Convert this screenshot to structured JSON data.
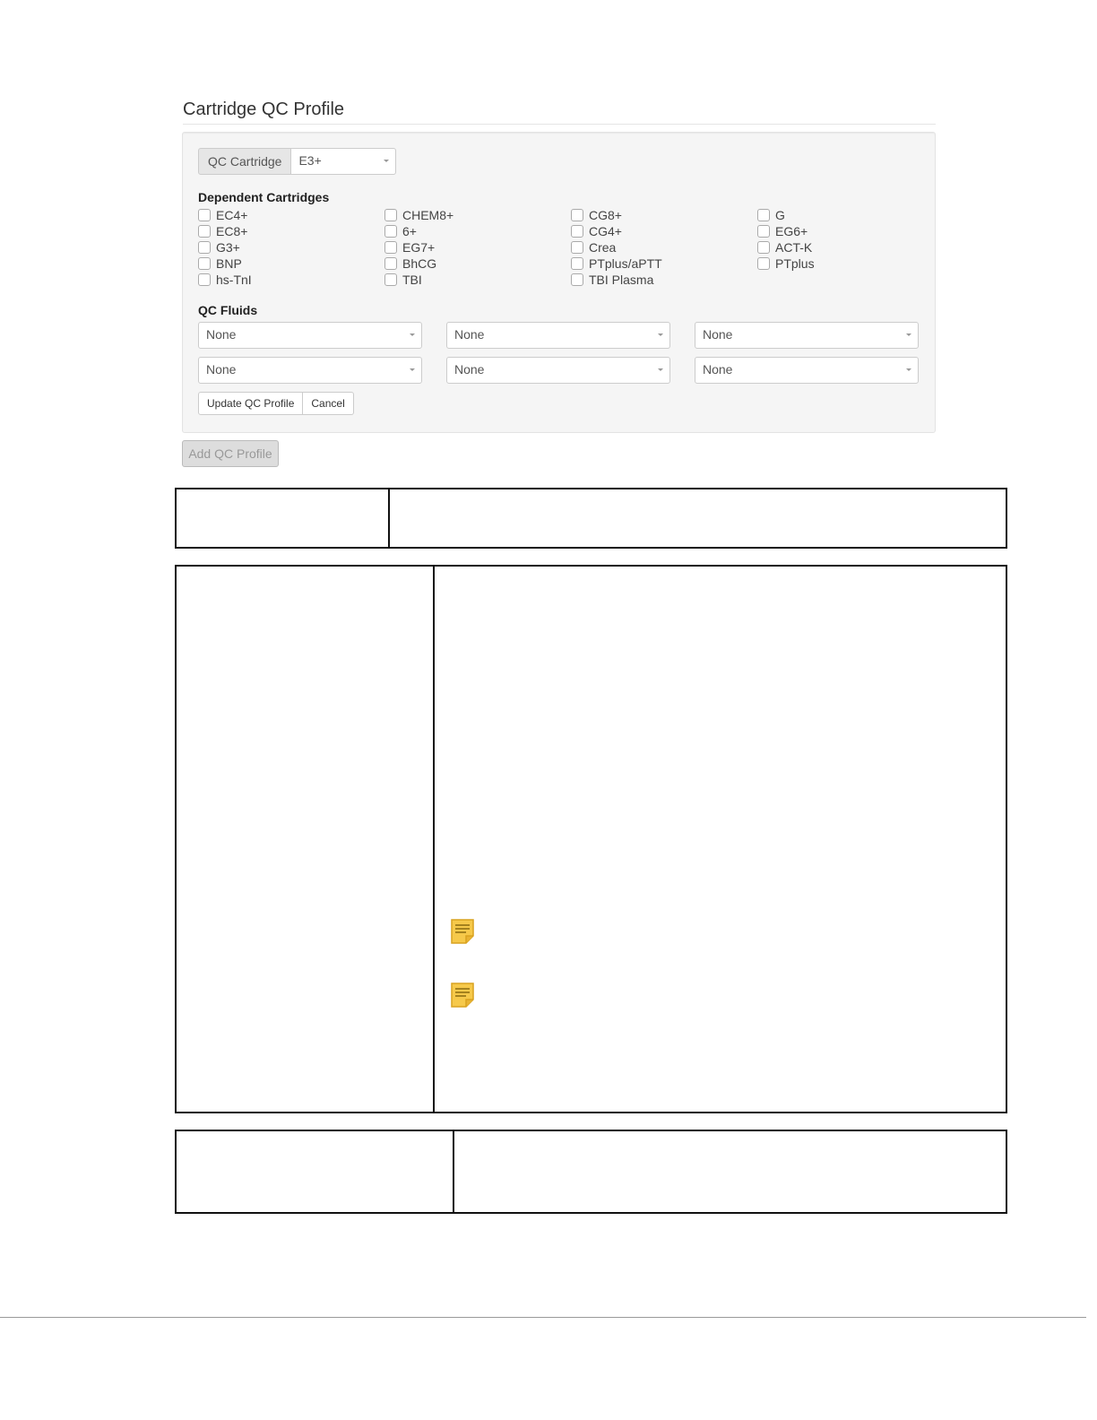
{
  "section_title": "Cartridge QC Profile",
  "qc_cartridge": {
    "label": "QC Cartridge",
    "value": "E3+"
  },
  "dependent_cartridges": {
    "heading": "Dependent Cartridges",
    "items": [
      [
        "EC4+",
        "CHEM8+",
        "CG8+",
        "G"
      ],
      [
        "EC8+",
        "6+",
        "CG4+",
        "EG6+"
      ],
      [
        "G3+",
        "EG7+",
        "Crea",
        "ACT-K"
      ],
      [
        "BNP",
        "BhCG",
        "PTplus/aPTT",
        "PTplus"
      ],
      [
        "hs-TnI",
        "TBI",
        "TBI Plasma"
      ]
    ]
  },
  "qc_fluids": {
    "heading": "QC Fluids",
    "values": [
      "None",
      "None",
      "None",
      "None",
      "None",
      "None"
    ]
  },
  "buttons": {
    "update": "Update QC Profile",
    "cancel": "Cancel",
    "add": "Add QC Profile"
  },
  "icons": {
    "note": "note-icon"
  },
  "colors": {
    "note_fill": "#f6c94a",
    "note_stroke": "#d9a21f"
  }
}
